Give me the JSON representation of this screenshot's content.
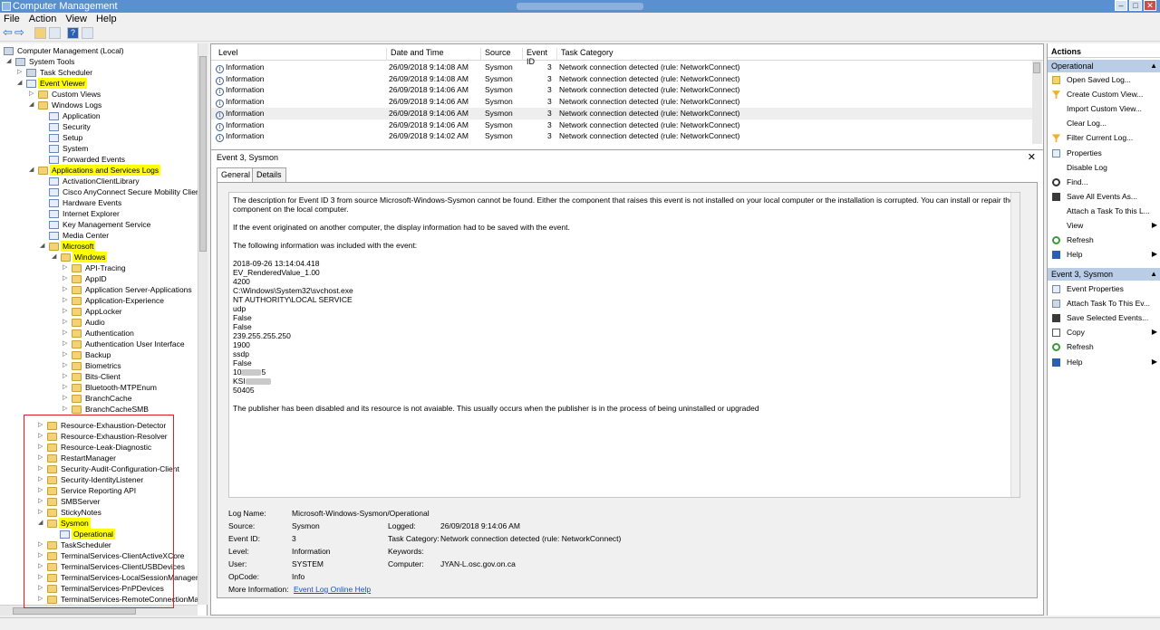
{
  "window": {
    "title": "Computer Management"
  },
  "menu": [
    "File",
    "Action",
    "View",
    "Help"
  ],
  "tree": {
    "rows": [
      {
        "label": "Computer Management (Local)",
        "indent": 0,
        "arrow": "",
        "icon": "gen"
      },
      {
        "label": "System Tools",
        "indent": 1,
        "arrow": "◢",
        "icon": "gen"
      },
      {
        "label": "Task Scheduler",
        "indent": 2,
        "arrow": "▷",
        "icon": "gen"
      },
      {
        "label": "Event Viewer",
        "indent": 2,
        "arrow": "◢",
        "icon": "log",
        "hl": true
      },
      {
        "label": "Custom Views",
        "indent": 3,
        "arrow": "▷",
        "icon": "folder"
      },
      {
        "label": "Windows Logs",
        "indent": 3,
        "arrow": "◢",
        "icon": "folder"
      },
      {
        "label": "Application",
        "indent": 4,
        "arrow": "",
        "icon": "log"
      },
      {
        "label": "Security",
        "indent": 4,
        "arrow": "",
        "icon": "log"
      },
      {
        "label": "Setup",
        "indent": 4,
        "arrow": "",
        "icon": "log"
      },
      {
        "label": "System",
        "indent": 4,
        "arrow": "",
        "icon": "log"
      },
      {
        "label": "Forwarded Events",
        "indent": 4,
        "arrow": "",
        "icon": "log"
      },
      {
        "label": "Applications and Services Logs",
        "indent": 3,
        "arrow": "◢",
        "icon": "folder",
        "hl": true
      },
      {
        "label": "ActivationClientLibrary",
        "indent": 4,
        "arrow": "",
        "icon": "log"
      },
      {
        "label": "Cisco AnyConnect Secure Mobility Client",
        "indent": 4,
        "arrow": "",
        "icon": "log"
      },
      {
        "label": "Hardware Events",
        "indent": 4,
        "arrow": "",
        "icon": "log"
      },
      {
        "label": "Internet Explorer",
        "indent": 4,
        "arrow": "",
        "icon": "log"
      },
      {
        "label": "Key Management Service",
        "indent": 4,
        "arrow": "",
        "icon": "log"
      },
      {
        "label": "Media Center",
        "indent": 4,
        "arrow": "",
        "icon": "log"
      },
      {
        "label": "Microsoft",
        "indent": 4,
        "arrow": "◢",
        "icon": "folder",
        "hl": true
      },
      {
        "label": "Windows",
        "indent": 5,
        "arrow": "◢",
        "icon": "folder",
        "hl": true
      },
      {
        "label": "API-Tracing",
        "indent": 6,
        "arrow": "▷",
        "icon": "folder"
      },
      {
        "label": "AppID",
        "indent": 6,
        "arrow": "▷",
        "icon": "folder"
      },
      {
        "label": "Application Server-Applications",
        "indent": 6,
        "arrow": "▷",
        "icon": "folder"
      },
      {
        "label": "Application-Experience",
        "indent": 6,
        "arrow": "▷",
        "icon": "folder"
      },
      {
        "label": "AppLocker",
        "indent": 6,
        "arrow": "▷",
        "icon": "folder"
      },
      {
        "label": "Audio",
        "indent": 6,
        "arrow": "▷",
        "icon": "folder"
      },
      {
        "label": "Authentication",
        "indent": 6,
        "arrow": "▷",
        "icon": "folder"
      },
      {
        "label": "Authentication User Interface",
        "indent": 6,
        "arrow": "▷",
        "icon": "folder"
      },
      {
        "label": "Backup",
        "indent": 6,
        "arrow": "▷",
        "icon": "folder"
      },
      {
        "label": "Biometrics",
        "indent": 6,
        "arrow": "▷",
        "icon": "folder"
      },
      {
        "label": "Bits-Client",
        "indent": 6,
        "arrow": "▷",
        "icon": "folder"
      },
      {
        "label": "Bluetooth-MTPEnum",
        "indent": 6,
        "arrow": "▷",
        "icon": "folder"
      },
      {
        "label": "BranchCache",
        "indent": 6,
        "arrow": "▷",
        "icon": "folder"
      },
      {
        "label": "BranchCacheSMB",
        "indent": 6,
        "arrow": "▷",
        "icon": "folder"
      }
    ],
    "rows2": [
      {
        "label": "Resource-Exhaustion-Detector",
        "arrow": "▷",
        "icon": "folder"
      },
      {
        "label": "Resource-Exhaustion-Resolver",
        "arrow": "▷",
        "icon": "folder"
      },
      {
        "label": "Resource-Leak-Diagnostic",
        "arrow": "▷",
        "icon": "folder"
      },
      {
        "label": "RestartManager",
        "arrow": "▷",
        "icon": "folder"
      },
      {
        "label": "Security-Audit-Configuration-Client",
        "arrow": "▷",
        "icon": "folder"
      },
      {
        "label": "Security-IdentityListener",
        "arrow": "▷",
        "icon": "folder"
      },
      {
        "label": "Service Reporting API",
        "arrow": "▷",
        "icon": "folder"
      },
      {
        "label": "SMBServer",
        "arrow": "▷",
        "icon": "folder"
      },
      {
        "label": "StickyNotes",
        "arrow": "▷",
        "icon": "folder"
      },
      {
        "label": "Sysmon",
        "arrow": "◢",
        "icon": "folder",
        "hl": true
      },
      {
        "label": "Operational",
        "arrow": "",
        "icon": "log",
        "hl": true,
        "sub": true
      },
      {
        "label": "TaskScheduler",
        "arrow": "▷",
        "icon": "folder"
      },
      {
        "label": "TerminalServices-ClientActiveXCore",
        "arrow": "▷",
        "icon": "folder"
      },
      {
        "label": "TerminalServices-ClientUSBDevices",
        "arrow": "▷",
        "icon": "folder"
      },
      {
        "label": "TerminalServices-LocalSessionManager",
        "arrow": "▷",
        "icon": "folder"
      },
      {
        "label": "TerminalServices-PnPDevices",
        "arrow": "▷",
        "icon": "folder"
      },
      {
        "label": "TerminalServices-RemoteConnectionManager",
        "arrow": "▷",
        "icon": "folder"
      }
    ]
  },
  "grid": {
    "headers": [
      "Level",
      "Date and Time",
      "Source",
      "Event ID",
      "Task Category"
    ],
    "rows": [
      {
        "level": "Information",
        "date": "26/09/2018 9:14:08 AM",
        "source": "Sysmon",
        "id": "3",
        "cat": "Network connection detected (rule: NetworkConnect)"
      },
      {
        "level": "Information",
        "date": "26/09/2018 9:14:08 AM",
        "source": "Sysmon",
        "id": "3",
        "cat": "Network connection detected (rule: NetworkConnect)"
      },
      {
        "level": "Information",
        "date": "26/09/2018 9:14:06 AM",
        "source": "Sysmon",
        "id": "3",
        "cat": "Network connection detected (rule: NetworkConnect)"
      },
      {
        "level": "Information",
        "date": "26/09/2018 9:14:06 AM",
        "source": "Sysmon",
        "id": "3",
        "cat": "Network connection detected (rule: NetworkConnect)"
      },
      {
        "level": "Information",
        "date": "26/09/2018 9:14:06 AM",
        "source": "Sysmon",
        "id": "3",
        "cat": "Network connection detected (rule: NetworkConnect)"
      },
      {
        "level": "Information",
        "date": "26/09/2018 9:14:06 AM",
        "source": "Sysmon",
        "id": "3",
        "cat": "Network connection detected (rule: NetworkConnect)"
      },
      {
        "level": "Information",
        "date": "26/09/2018 9:14:02 AM",
        "source": "Sysmon",
        "id": "3",
        "cat": "Network connection detected (rule: NetworkConnect)"
      }
    ]
  },
  "detail": {
    "title": "Event 3, Sysmon",
    "close": "✕",
    "tabs": [
      "General",
      "Details"
    ],
    "desc_p1": "The description for Event ID 3 from source Microsoft-Windows-Sysmon cannot be found. Either the component that raises this event is not installed on your local computer or the installation is corrupted. You can install or repair the component on the local computer.",
    "desc_p2": "If the event originated on another computer, the display information had to be saved with the event.",
    "desc_p3": "The following information was included with the event:",
    "lines": [
      "2018-09-26 13:14:04.418",
      "EV_RenderedValue_1.00",
      "4200",
      "C:\\Windows\\System32\\svchost.exe",
      "NT AUTHORITY\\LOCAL SERVICE",
      "udp",
      "False",
      "False",
      "239.255.255.250",
      "1900",
      "ssdp",
      "False"
    ],
    "line_ip_prefix": "10",
    "line_ip_suffix": "5",
    "line_host_prefix": "KSI",
    "line_port": "50405",
    "desc_p4": "The publisher has been disabled and its resource is not avaiable. This usually occurs when the publisher is in the process of being uninstalled or upgraded",
    "props": {
      "log_name_label": "Log Name:",
      "log_name": "Microsoft-Windows-Sysmon/Operational",
      "source_label": "Source:",
      "source": "Sysmon",
      "logged_label": "Logged:",
      "logged": "26/09/2018 9:14:06 AM",
      "event_id_label": "Event ID:",
      "event_id": "3",
      "task_cat_label": "Task Category:",
      "task_cat": "Network connection detected (rule: NetworkConnect)",
      "level_label": "Level:",
      "level": "Information",
      "keywords_label": "Keywords:",
      "keywords": "",
      "user_label": "User:",
      "user": "SYSTEM",
      "computer_label": "Computer:",
      "computer": "JYAN-L.osc.gov.on.ca",
      "opcode_label": "OpCode:",
      "opcode": "Info",
      "more_info_label": "More Information:",
      "more_info_link": "Event Log Online Help"
    }
  },
  "actions": {
    "title": "Actions",
    "sec1": "Operational",
    "items1": [
      {
        "label": "Open Saved Log...",
        "icon": "folder"
      },
      {
        "label": "Create Custom View...",
        "icon": "funnel"
      },
      {
        "label": "Import Custom View...",
        "icon": "none"
      },
      {
        "label": "Clear Log...",
        "icon": "none"
      },
      {
        "label": "Filter Current Log...",
        "icon": "funnel"
      },
      {
        "label": "Properties",
        "icon": "props"
      },
      {
        "label": "Disable Log",
        "icon": "none"
      },
      {
        "label": "Find...",
        "icon": "find"
      },
      {
        "label": "Save All Events As...",
        "icon": "save"
      },
      {
        "label": "Attach a Task To this L...",
        "icon": "none"
      },
      {
        "label": "View",
        "icon": "none",
        "sub": true
      },
      {
        "label": "Refresh",
        "icon": "refresh"
      },
      {
        "label": "Help",
        "icon": "help",
        "sub": true
      }
    ],
    "sec2": "Event 3, Sysmon",
    "items2": [
      {
        "label": "Event Properties",
        "icon": "props"
      },
      {
        "label": "Attach Task To This Ev...",
        "icon": "task"
      },
      {
        "label": "Save Selected Events...",
        "icon": "save"
      },
      {
        "label": "Copy",
        "icon": "copy",
        "sub": true
      },
      {
        "label": "Refresh",
        "icon": "refresh"
      },
      {
        "label": "Help",
        "icon": "help",
        "sub": true
      }
    ]
  }
}
